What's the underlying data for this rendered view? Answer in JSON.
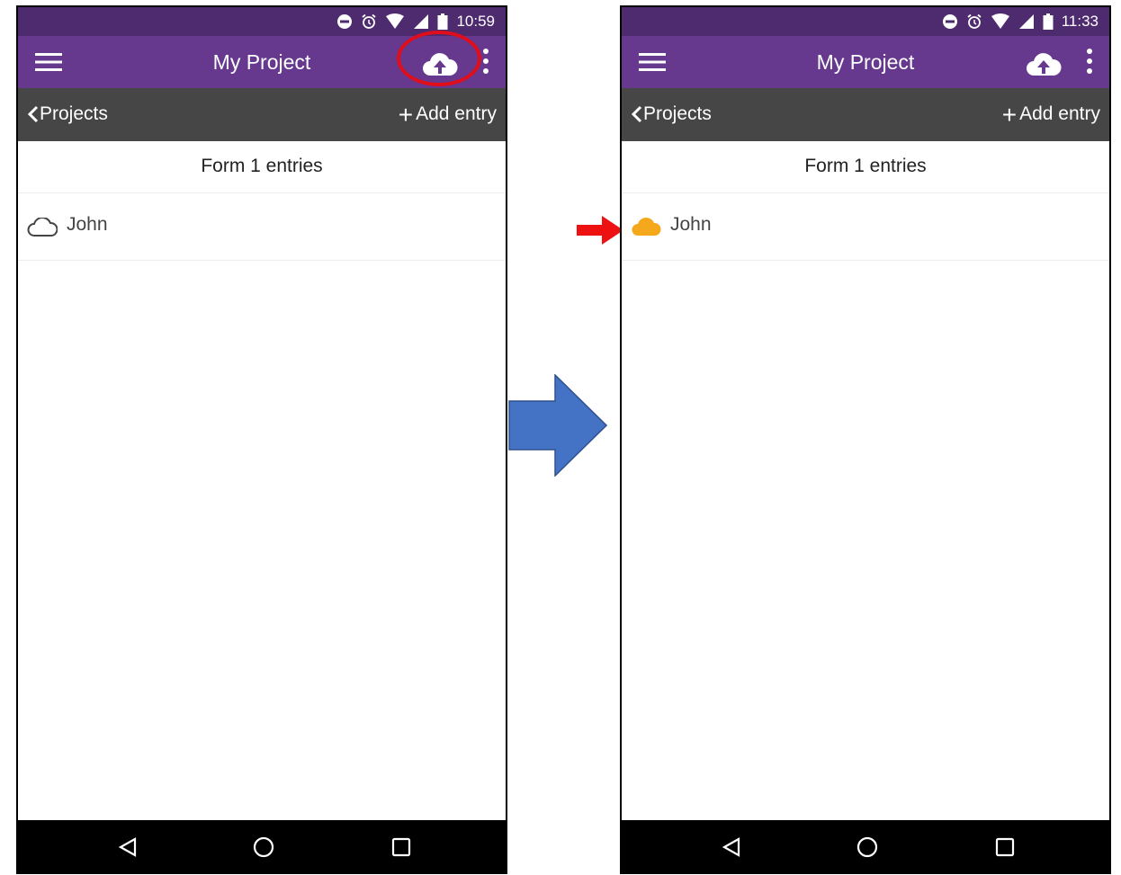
{
  "screens": [
    {
      "status_time": "10:59",
      "app_title": "My Project",
      "back_label": "Projects",
      "add_label": "Add entry",
      "form_title": "Form 1 entries",
      "entry_name": "John",
      "entry_cloud_state": "outline (not uploaded)",
      "upload_button_highlighted": true
    },
    {
      "status_time": "11:33",
      "app_title": "My Project",
      "back_label": "Projects",
      "add_label": "Add entry",
      "form_title": "Form 1 entries",
      "entry_name": "John",
      "entry_cloud_state": "filled orange (uploaded)",
      "upload_button_highlighted": false
    }
  ],
  "icons": [
    "menu-icon",
    "cloud-upload-icon",
    "more-vert-icon",
    "chevron-left-icon",
    "plus-icon",
    "cloud-icon",
    "back-triangle-icon",
    "home-circle-icon",
    "recents-square-icon",
    "wifi-icon",
    "signal-icon",
    "battery-icon",
    "alarm-icon",
    "dnd-icon"
  ],
  "colors": {
    "status_bar": "#4e2a6f",
    "app_bar": "#66398f",
    "nav_bar": "#464646",
    "uploaded_cloud": "#f6a81c",
    "highlight": "#e00d1a",
    "transition_arrow": "#4472c4"
  }
}
